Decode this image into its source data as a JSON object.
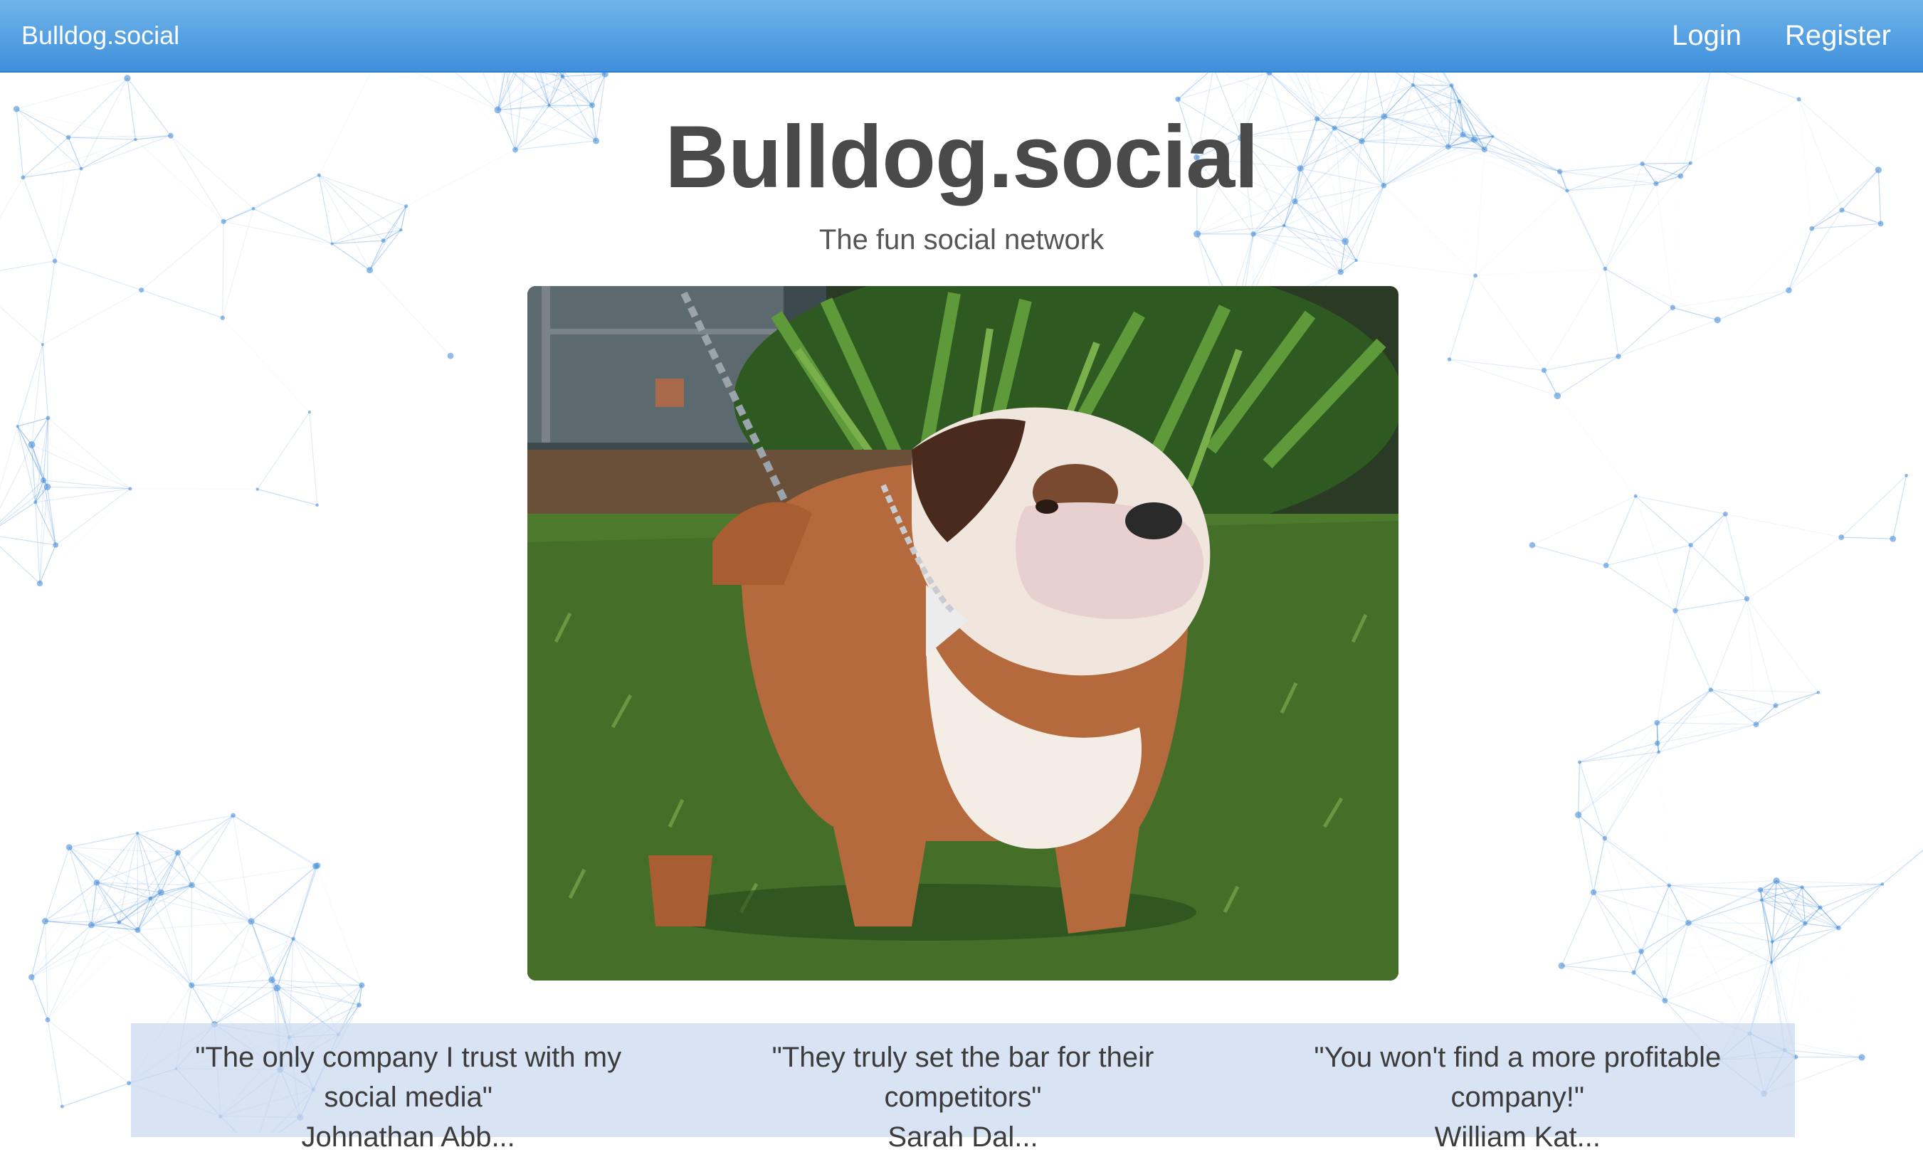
{
  "navbar": {
    "brand": "Bulldog.social",
    "login_label": "Login",
    "register_label": "Register",
    "colors": {
      "top": "#6fb5ea",
      "bottom": "#3f8fdc",
      "text": "#ffffff"
    }
  },
  "hero": {
    "title": "Bulldog.social",
    "subtitle": "The fun social network",
    "image_alt": "English bulldog standing on grass on a chain leash"
  },
  "testimonials": [
    {
      "quote": "\"The only company I trust with my social media\"",
      "author": "Johnathan Abb..."
    },
    {
      "quote": "\"They truly set the bar for their competitors\"",
      "author": "Sarah Dal..."
    },
    {
      "quote": "\"You won't find a more profitable company!\"",
      "author": "William Kat..."
    }
  ],
  "colors": {
    "network_lines": "#4a90d9",
    "testimonial_band": "#cbdaf0",
    "title_text": "#4a4a4a"
  }
}
